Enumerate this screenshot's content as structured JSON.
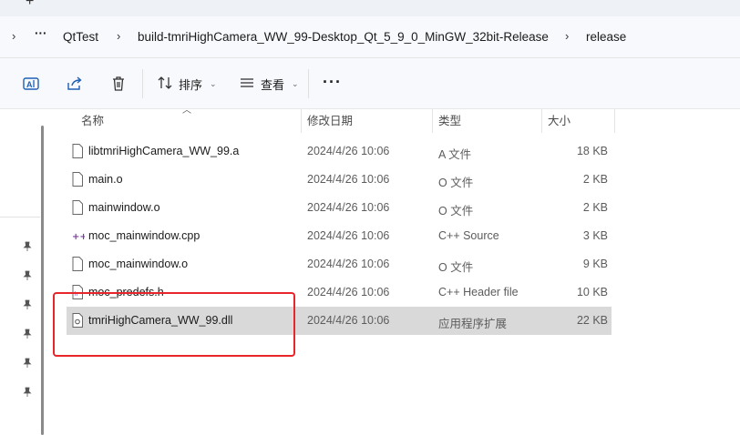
{
  "tabstrip": {
    "new_tab": "+"
  },
  "breadcrumb": {
    "more": "···",
    "items": [
      "QtTest",
      "build-tmriHighCamera_WW_99-Desktop_Qt_5_9_0_MinGW_32bit-Release",
      "release"
    ]
  },
  "toolbar": {
    "sort_label": "排序",
    "view_label": "查看",
    "more": "···"
  },
  "columns": {
    "name": "名称",
    "date": "修改日期",
    "type": "类型",
    "size": "大小"
  },
  "files": [
    {
      "name": "libtmriHighCamera_WW_99.a",
      "date": "2024/4/26 10:06",
      "type": "A 文件",
      "size": "18 KB",
      "icon": "file-icon"
    },
    {
      "name": "main.o",
      "date": "2024/4/26 10:06",
      "type": "O 文件",
      "size": "2 KB",
      "icon": "file-icon"
    },
    {
      "name": "mainwindow.o",
      "date": "2024/4/26 10:06",
      "type": "O 文件",
      "size": "2 KB",
      "icon": "file-icon"
    },
    {
      "name": "moc_mainwindow.cpp",
      "date": "2024/4/26 10:06",
      "type": "C++ Source",
      "size": "3 KB",
      "icon": "cpp-source-icon"
    },
    {
      "name": "moc_mainwindow.o",
      "date": "2024/4/26 10:06",
      "type": "O 文件",
      "size": "9 KB",
      "icon": "file-icon"
    },
    {
      "name": "moc_predefs.h",
      "date": "2024/4/26 10:06",
      "type": "C++ Header file",
      "size": "10 KB",
      "icon": "header-file-icon"
    },
    {
      "name": "tmriHighCamera_WW_99.dll",
      "date": "2024/4/26 10:06",
      "type": "应用程序扩展",
      "size": "22 KB",
      "icon": "dll-file-icon",
      "selected": true
    }
  ],
  "colors": {
    "accent": "#1e5fb4",
    "highlight_box": "#e8262a",
    "selected_row": "#d9d9d9"
  }
}
